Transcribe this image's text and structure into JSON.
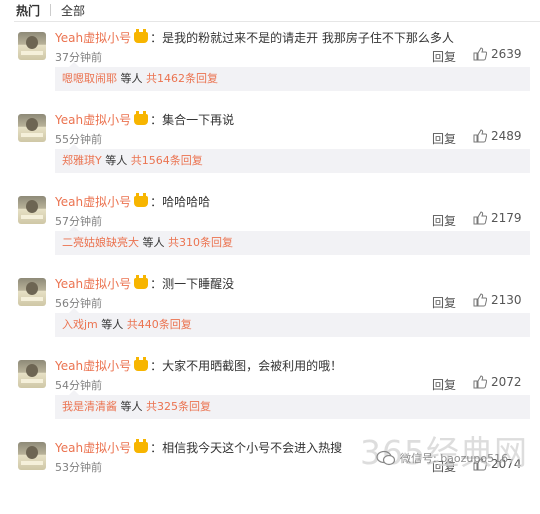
{
  "tabs": {
    "hot": "热门",
    "all": "全部"
  },
  "comments": [
    {
      "user": "Yeah虚拟小号",
      "text": "：是我的粉就过来不是的请走开 我那房子住不下那么多人",
      "time": "37分钟前",
      "reply": "回复",
      "likes": "2639",
      "sub": {
        "name": "嗯嗯取闹耶",
        "mid": "等人",
        "count": "共1462条回复"
      }
    },
    {
      "user": "Yeah虚拟小号",
      "text": "：集合一下再说",
      "time": "55分钟前",
      "reply": "回复",
      "likes": "2489",
      "sub": {
        "name": "郑雅琪Y",
        "mid": "等人",
        "count": "共1564条回复"
      }
    },
    {
      "user": "Yeah虚拟小号",
      "text": "：哈哈哈哈",
      "time": "57分钟前",
      "reply": "回复",
      "likes": "2179",
      "sub": {
        "name": "二亮姑娘缺亮大",
        "mid": "等人",
        "count": "共310条回复"
      }
    },
    {
      "user": "Yeah虚拟小号",
      "text": "：测一下睡醒没",
      "time": "56分钟前",
      "reply": "回复",
      "likes": "2130",
      "sub": {
        "name": "入戏jm",
        "mid": "等人",
        "count": "共440条回复"
      }
    },
    {
      "user": "Yeah虚拟小号",
      "text": "：大家不用晒截图，会被利用的哦！",
      "time": "54分钟前",
      "reply": "回复",
      "likes": "2072",
      "sub": {
        "name": "我是清清酱",
        "mid": "等人",
        "count": "共325条回复"
      }
    },
    {
      "user": "Yeah虚拟小号",
      "text": "：相信我今天这个小号不会进入热搜",
      "time": "53分钟前",
      "reply": "回复",
      "likes": "2074"
    }
  ],
  "watermark": {
    "site": "365经典网",
    "wechat": "微信号: baozupo516"
  },
  "icons": {
    "thumb": "thumbs-up-icon",
    "vip": "crown-icon",
    "wechat": "wechat-icon"
  },
  "colors": {
    "username": "#eb7350",
    "subbox": "#f2f2f5"
  }
}
